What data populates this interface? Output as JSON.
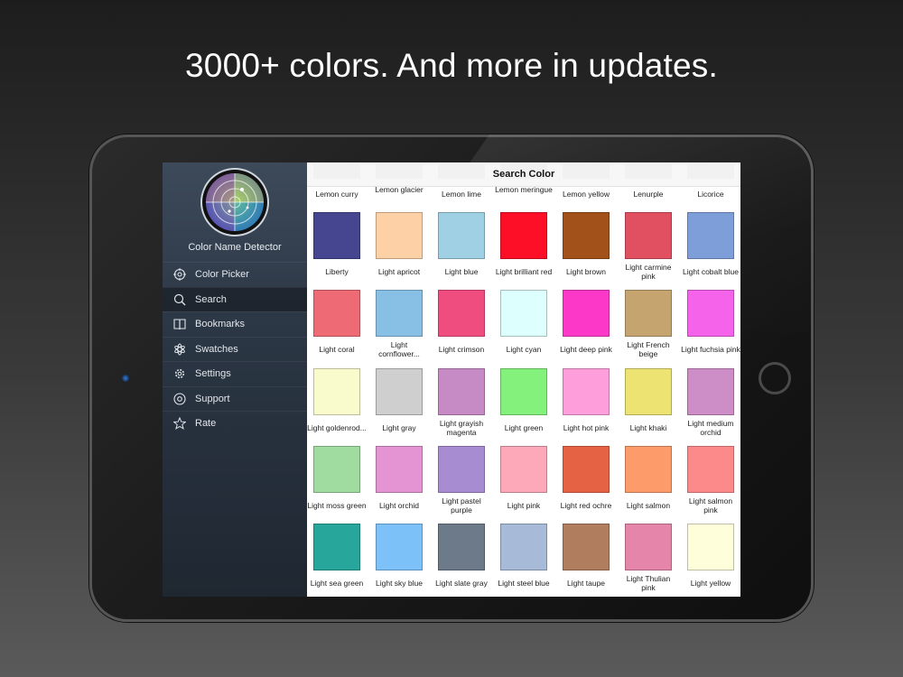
{
  "headline": "3000+ colors. And more in updates.",
  "app": {
    "name": "Color Name Detector",
    "nav_title": "Search Color"
  },
  "menu": [
    {
      "label": "Color Picker",
      "icon": "target-icon",
      "active": false
    },
    {
      "label": "Search",
      "icon": "search-icon",
      "active": true
    },
    {
      "label": "Bookmarks",
      "icon": "book-icon",
      "active": false
    },
    {
      "label": "Swatches",
      "icon": "flower-icon",
      "active": false
    },
    {
      "label": "Settings",
      "icon": "gear-icon",
      "active": false
    },
    {
      "label": "Support",
      "icon": "at-sign-icon",
      "active": false
    },
    {
      "label": "Rate",
      "icon": "star-icon",
      "active": false
    }
  ],
  "top_row_labels": [
    "Lemon curry",
    "Lemon glacier",
    "Lemon lime",
    "Lemon meringue",
    "Lemon yellow",
    "Lenurple",
    "Licorice"
  ],
  "colors": [
    {
      "name": "Liberty",
      "hex": "#45468f"
    },
    {
      "name": "Light apricot",
      "hex": "#fdd0a6"
    },
    {
      "name": "Light blue",
      "hex": "#a0d0e3"
    },
    {
      "name": "Light brilliant red",
      "hex": "#fd0f28"
    },
    {
      "name": "Light brown",
      "hex": "#a15119"
    },
    {
      "name": "Light carmine pink",
      "hex": "#e05060"
    },
    {
      "name": "Light cobalt blue",
      "hex": "#7d9ed9"
    },
    {
      "name": "Light coral",
      "hex": "#ee6b75"
    },
    {
      "name": "Light cornflower...",
      "hex": "#88c0e5"
    },
    {
      "name": "Light crimson",
      "hex": "#ef4d80"
    },
    {
      "name": "Light cyan",
      "hex": "#ddfffd"
    },
    {
      "name": "Light deep pink",
      "hex": "#fb38c8"
    },
    {
      "name": "Light French beige",
      "hex": "#c6a46f"
    },
    {
      "name": "Light fuchsia pink",
      "hex": "#f563eb"
    },
    {
      "name": "Light goldenrod...",
      "hex": "#fafbcc"
    },
    {
      "name": "Light gray",
      "hex": "#cfcfcf"
    },
    {
      "name": "Light grayish magenta",
      "hex": "#c68ac4"
    },
    {
      "name": "Light green",
      "hex": "#84f17c"
    },
    {
      "name": "Light hot pink",
      "hex": "#fe9fdb"
    },
    {
      "name": "Light khaki",
      "hex": "#ede372"
    },
    {
      "name": "Light medium orchid",
      "hex": "#cd8dc6"
    },
    {
      "name": "Light moss green",
      "hex": "#a0dc9f"
    },
    {
      "name": "Light orchid",
      "hex": "#e494d3"
    },
    {
      "name": "Light pastel purple",
      "hex": "#a78cd2"
    },
    {
      "name": "Light pink",
      "hex": "#fda9ba"
    },
    {
      "name": "Light red ochre",
      "hex": "#e56244"
    },
    {
      "name": "Light salmon",
      "hex": "#fd9b6b"
    },
    {
      "name": "Light salmon pink",
      "hex": "#fd8a8a"
    },
    {
      "name": "Light sea green",
      "hex": "#27a79b"
    },
    {
      "name": "Light sky blue",
      "hex": "#7cc1f8"
    },
    {
      "name": "Light slate gray",
      "hex": "#6c7a8a"
    },
    {
      "name": "Light steel blue",
      "hex": "#a7bad8"
    },
    {
      "name": "Light taupe",
      "hex": "#b07d5e"
    },
    {
      "name": "Light Thulian pink",
      "hex": "#e585a9"
    },
    {
      "name": "Light yellow",
      "hex": "#fefedb"
    }
  ]
}
